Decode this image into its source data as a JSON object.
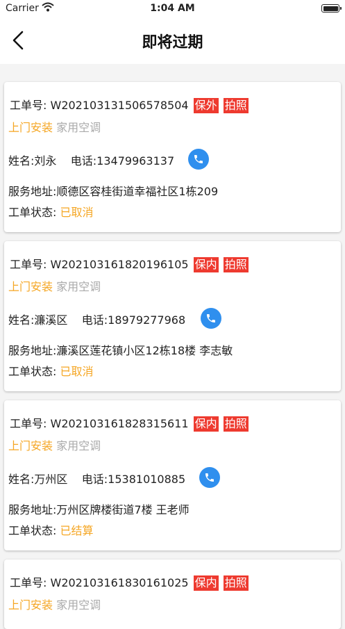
{
  "status_bar": {
    "carrier": "Carrier",
    "time": "1:04 AM"
  },
  "nav": {
    "title": "即将过期"
  },
  "labels": {
    "order_no": "工单号:",
    "name": "姓名:",
    "phone": "电话:",
    "address": "服务地址:",
    "status": "工单状态:"
  },
  "orders": [
    {
      "order_no": "W202103131506578504",
      "tags": [
        "保外",
        "拍照"
      ],
      "service_type": "上门安装",
      "product": "家用空调",
      "name": "刘永",
      "phone": "13479963137",
      "address": "顺德区容桂街道幸福社区1栋209",
      "status": "已取消"
    },
    {
      "order_no": "W202103161820196105",
      "tags": [
        "保内",
        "拍照"
      ],
      "service_type": "上门安装",
      "product": "家用空调",
      "name": "濂溪区",
      "phone": "18979277968",
      "address": "濂溪区莲花镇小区12栋18楼 李志敏",
      "status": "已取消"
    },
    {
      "order_no": "W202103161828315611",
      "tags": [
        "保内",
        "拍照"
      ],
      "service_type": "上门安装",
      "product": "家用空调",
      "name": "万州区",
      "phone": "15381010885",
      "address": "万州区牌楼街道7楼  王老师",
      "status": "已结算"
    },
    {
      "order_no": "W202103161830161025",
      "tags": [
        "保内",
        "拍照"
      ],
      "service_type": "上门安装",
      "product": "家用空调"
    }
  ],
  "colors": {
    "tag_red": "#ee3a2f",
    "accent_orange": "#f5a623",
    "phone_blue": "#2f8fee"
  },
  "icons": {
    "back": "chevron-left-icon",
    "phone": "phone-icon",
    "wifi": "wifi-icon",
    "battery": "battery-icon"
  }
}
